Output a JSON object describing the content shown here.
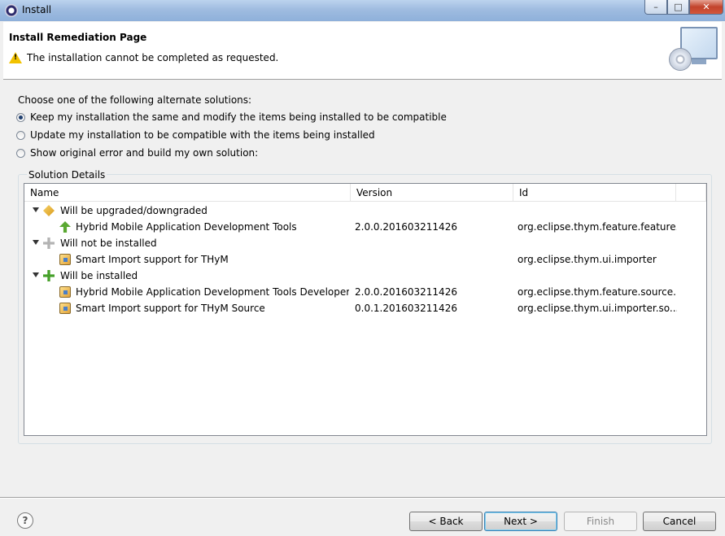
{
  "window": {
    "title": "Install",
    "min_glyph": "–",
    "max_glyph": "□",
    "close_glyph": "✕"
  },
  "header": {
    "title": "Install Remediation Page",
    "message": "The installation cannot be completed as requested.",
    "warning_glyph": "!"
  },
  "options": {
    "label": "Choose one of the following alternate solutions:",
    "items": [
      {
        "label": "Keep my installation the same and modify the items being installed to be compatible",
        "selected": true
      },
      {
        "label": "Update my installation to be compatible with the items being installed",
        "selected": false
      },
      {
        "label": "Show original error and build my own solution:",
        "selected": false
      }
    ]
  },
  "details": {
    "group_label": "Solution Details",
    "columns": [
      "Name",
      "Version",
      "Id"
    ],
    "rows": [
      {
        "name": "Will be upgraded/downgraded",
        "version": "",
        "id": "",
        "level": 0,
        "icon": "update-icon"
      },
      {
        "name": "Hybrid Mobile Application Development Tools",
        "version": "2.0.0.201603211426",
        "id": "org.eclipse.thym.feature.feature...",
        "level": 1,
        "icon": "arrow-up-icon"
      },
      {
        "name": "Will not be installed",
        "version": "",
        "id": "",
        "level": 0,
        "icon": "plus-grey-icon"
      },
      {
        "name": "Smart Import support for THyM",
        "version": "",
        "id": "org.eclipse.thym.ui.importer",
        "level": 1,
        "icon": "plugin-icon"
      },
      {
        "name": "Will be installed",
        "version": "",
        "id": "",
        "level": 0,
        "icon": "plus-green-icon"
      },
      {
        "name": "Hybrid Mobile Application Development Tools Developer",
        "version": "2.0.0.201603211426",
        "id": "org.eclipse.thym.feature.source...",
        "level": 1,
        "icon": "plugin-icon"
      },
      {
        "name": "Smart Import support for THyM Source",
        "version": "0.0.1.201603211426",
        "id": "org.eclipse.thym.ui.importer.so...",
        "level": 1,
        "icon": "plugin-icon"
      }
    ]
  },
  "buttons": {
    "help": "?",
    "back": "< Back",
    "next": "Next >",
    "finish": "Finish",
    "cancel": "Cancel"
  }
}
